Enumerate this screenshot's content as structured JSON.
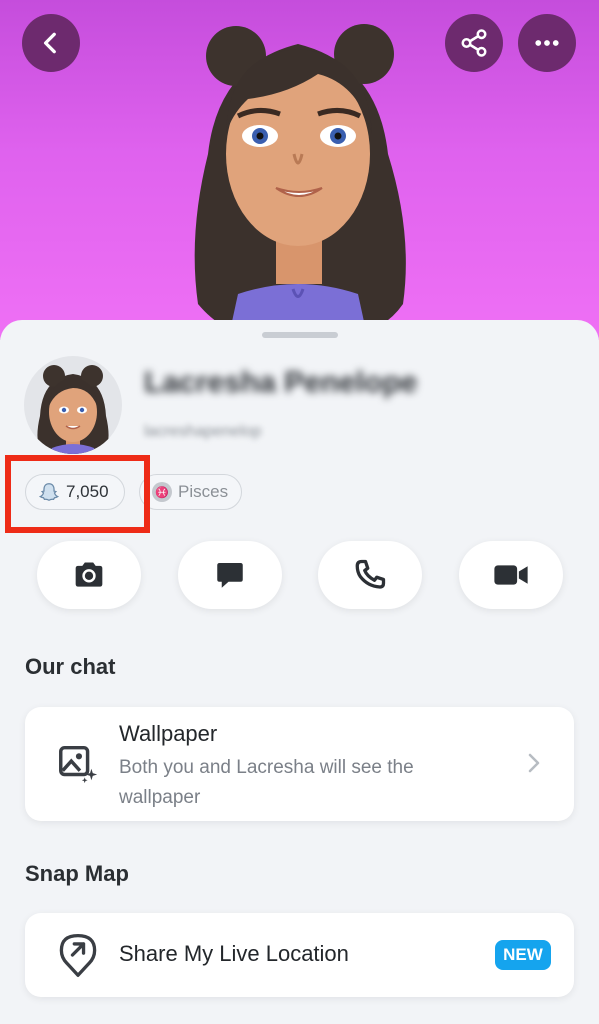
{
  "header": {
    "back_icon": "chevron-left-icon",
    "share_icon": "share-icon",
    "more_icon": "more-horizontal-icon",
    "colors": {
      "gradient_top": "#c54ddc",
      "gradient_bottom": "#ef70f5",
      "button_bg": "#6d2a6e"
    }
  },
  "profile": {
    "display_name": "Lacresha Penelope",
    "username": "lacreshapenelop",
    "score": "7,050",
    "zodiac": "Pisces"
  },
  "actions": [
    {
      "name": "camera",
      "icon": "camera-icon"
    },
    {
      "name": "chat",
      "icon": "chat-bubble-icon"
    },
    {
      "name": "call",
      "icon": "phone-icon"
    },
    {
      "name": "video",
      "icon": "video-camera-icon"
    }
  ],
  "our_chat": {
    "title": "Our chat",
    "wallpaper": {
      "title": "Wallpaper",
      "subtitle": "Both you and Lacresha will see the wallpaper"
    }
  },
  "snap_map": {
    "title": "Snap Map",
    "share_location": {
      "title": "Share My Live Location",
      "badge": "NEW"
    }
  },
  "colors": {
    "highlight": "#ee2b17",
    "badge": "#15a4ee"
  }
}
